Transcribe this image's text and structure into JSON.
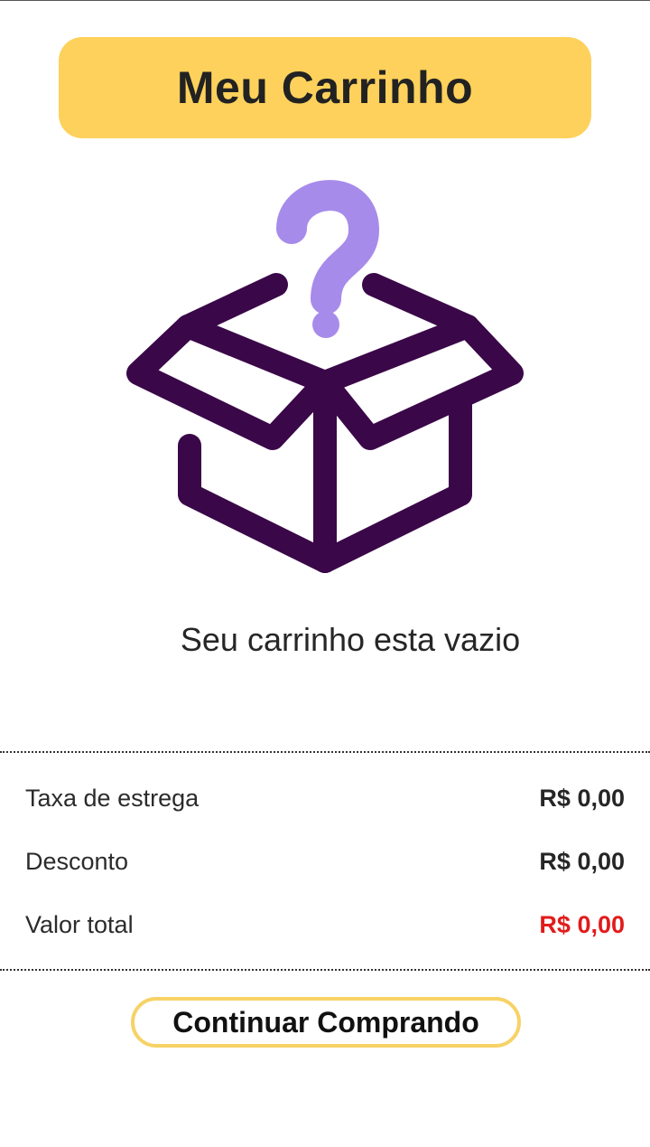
{
  "header": {
    "title": "Meu Carrinho"
  },
  "illustration": {
    "icon": "empty-box-question-icon",
    "box_color": "#3a0748",
    "question_color": "#a78bea"
  },
  "cart": {
    "empty_message": "Seu carrinho esta vazio"
  },
  "summary": {
    "rows": [
      {
        "label": "Taxa de estrega",
        "value": "R$ 0,00"
      },
      {
        "label": "Desconto",
        "value": "R$ 0,00"
      },
      {
        "label": "Valor total",
        "value": "R$ 0,00"
      }
    ]
  },
  "actions": {
    "continue_label": "Continuar Comprando"
  },
  "colors": {
    "accent": "#fdd15b",
    "total_value": "#e21b1b",
    "button_border": "#f7d266"
  }
}
